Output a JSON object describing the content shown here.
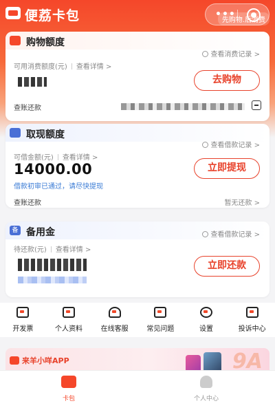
{
  "header": {
    "app_title": "便荔卡包",
    "slogan": "先购物.后消费",
    "more_menu": "•••"
  },
  "shopping_card": {
    "title": "购物额度",
    "record_link": "查看消费记录 >",
    "sub_label": "可用消费额度(元)",
    "detail_link": "查看详情 >",
    "button": "去购物",
    "bill_label": "查账还款"
  },
  "cash_card": {
    "title": "取现额度",
    "record_link": "查看借款记录 >",
    "sub_label": "可借金额(元)",
    "detail_link": "查看详情 >",
    "amount": "14000.00",
    "hint": "借款初审已通过，请尽快提现",
    "button": "立即提现",
    "bill_label": "查账还款",
    "bill_status": "暂无还款 >"
  },
  "reserve_card": {
    "icon_char": "备",
    "title": "备用金",
    "record_link": "查看借款记录 >",
    "sub_label": "待还款(元)",
    "detail_link": "查看详情 >",
    "button": "立即还款"
  },
  "services": [
    {
      "label": "开发票",
      "icon": "invoice-icon"
    },
    {
      "label": "个人资料",
      "icon": "id-card-icon"
    },
    {
      "label": "在线客服",
      "icon": "headset-icon"
    },
    {
      "label": "常见问题",
      "icon": "question-icon"
    },
    {
      "label": "设置",
      "icon": "gear-icon"
    },
    {
      "label": "投诉中心",
      "icon": "complaint-icon"
    }
  ],
  "banner": {
    "text": "来羊小咩APP",
    "big_text": "9A"
  },
  "tabs": [
    {
      "label": "卡包",
      "active": true
    },
    {
      "label": "个人中心",
      "active": false
    }
  ],
  "colors": {
    "brand": "#f5472a",
    "link_blue": "#3a7bd5"
  }
}
